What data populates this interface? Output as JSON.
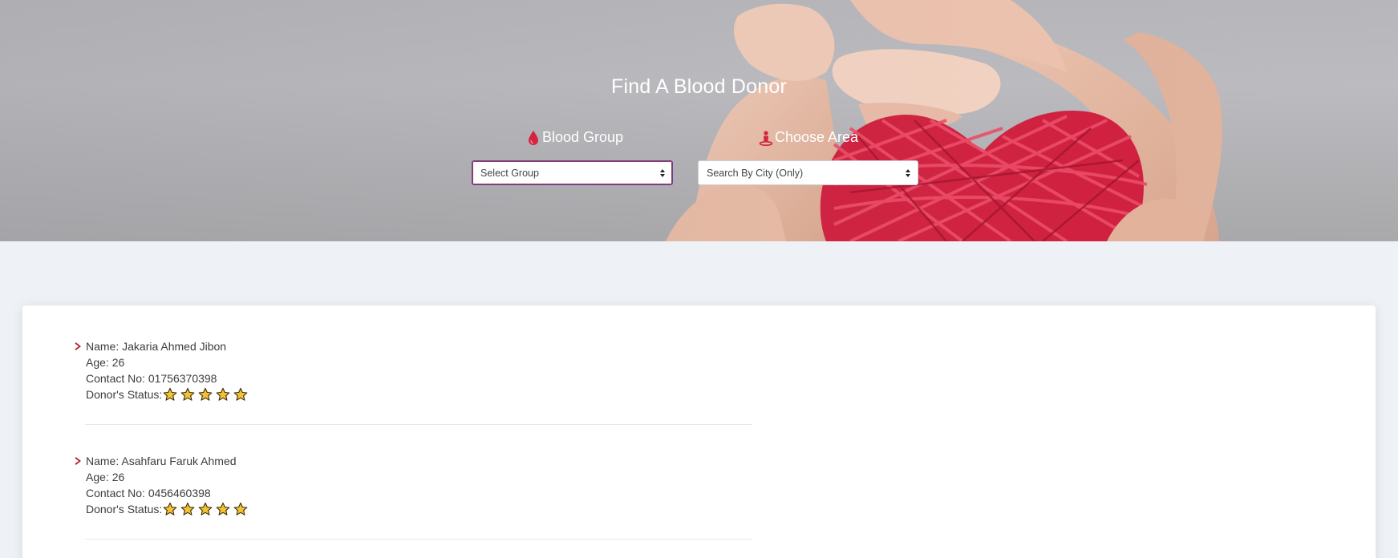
{
  "hero": {
    "title": "Find A Blood Donor",
    "blood_group_label": "Blood Group",
    "choose_area_label": "Choose Area",
    "group_select": {
      "value": "Select Group"
    },
    "city_select": {
      "value": "Search By City (Only)"
    }
  },
  "icons": {
    "blood": "blood-drop-icon",
    "area": "person-location-icon",
    "chevron": "chevron-right-icon",
    "star": "star-icon"
  },
  "colors": {
    "accent_red": "#d3253f",
    "chevron_red": "#b3212f",
    "star_fill": "#f2c232",
    "star_stroke": "#3a2a0a"
  },
  "donors": [
    {
      "name": "Name: Jakaria Ahmed Jibon",
      "age": "Age: 26",
      "contact": "Contact No: 01756370398",
      "status_label": "Donor's Status:",
      "rating": 5
    },
    {
      "name": "Name: Asahfaru Faruk Ahmed",
      "age": "Age: 26",
      "contact": "Contact No: 0456460398",
      "status_label": "Donor's Status:",
      "rating": 5
    }
  ]
}
